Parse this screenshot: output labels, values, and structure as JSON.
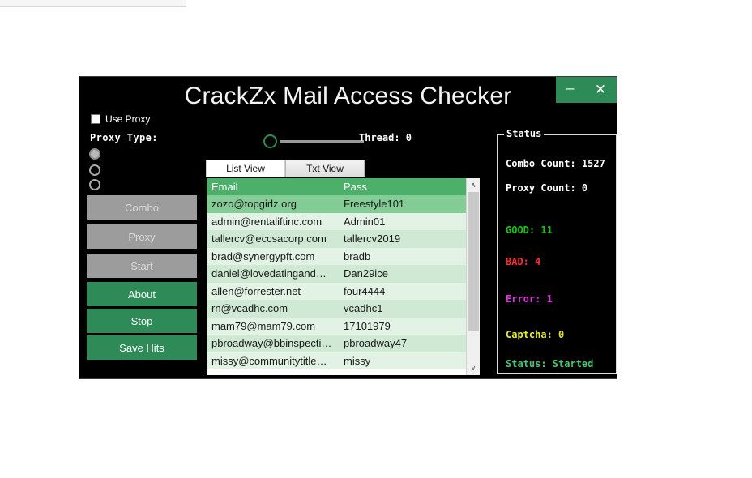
{
  "window": {
    "title": "CrackZx Mail Access Checker",
    "minimize_label": "–",
    "close_label": "✕",
    "accent_green": "#2e8b57",
    "background": "#000000"
  },
  "proxy": {
    "use_proxy_label": "Use Proxy",
    "use_proxy_checked": false,
    "type_label": "Proxy  Type:",
    "options": [
      "",
      "",
      ""
    ],
    "selected_index": 0
  },
  "buttons": [
    {
      "label": "Combo",
      "enabled": false
    },
    {
      "label": "Proxy",
      "enabled": false
    },
    {
      "label": "Start",
      "enabled": false
    },
    {
      "label": "About",
      "enabled": true
    },
    {
      "label": "Stop",
      "enabled": true
    },
    {
      "label": "Save Hits",
      "enabled": true
    }
  ],
  "thread": {
    "label": "Thread: 0",
    "value": 0,
    "slider_position_percent": 0
  },
  "tabs": [
    {
      "label": "List View",
      "active": true
    },
    {
      "label": "Txt View",
      "active": false
    }
  ],
  "table": {
    "columns": [
      "Email",
      "Pass"
    ],
    "rows": [
      {
        "email": "zozo@topgirlz.org",
        "pass": "Freestyle101"
      },
      {
        "email": "admin@rentaliftinc.com",
        "pass": "Admin01"
      },
      {
        "email": "tallercv@eccsacorp.com",
        "pass": "tallercv2019"
      },
      {
        "email": "brad@synergypft.com",
        "pass": "bradb"
      },
      {
        "email": "daniel@lovedatingand…",
        "pass": "Dan29ice"
      },
      {
        "email": "allen@forrester.net",
        "pass": "four4444"
      },
      {
        "email": "rn@vcadhc.com",
        "pass": "vcadhc1"
      },
      {
        "email": "mam79@mam79.com",
        "pass": "17101979"
      },
      {
        "email": "pbroadway@bbinspecti…",
        "pass": "pbroadway47"
      },
      {
        "email": "missy@communitytitle…",
        "pass": "missy"
      }
    ],
    "scroll_up_icon": "∧",
    "scroll_down_icon": "∨"
  },
  "status": {
    "legend": "Status",
    "combo_count": "Combo Count: 1527",
    "proxy_count": "Proxy Count: 0",
    "good": "GOOD: 11",
    "bad": "BAD: 4",
    "error": "Error: 1",
    "captcha": "Captcha: 0",
    "state": "Status: Started",
    "colors": {
      "good": "#13c713",
      "bad": "#ff2d2d",
      "error": "#e02fe0",
      "captcha": "#e8e82e",
      "state": "#46c46e"
    }
  }
}
